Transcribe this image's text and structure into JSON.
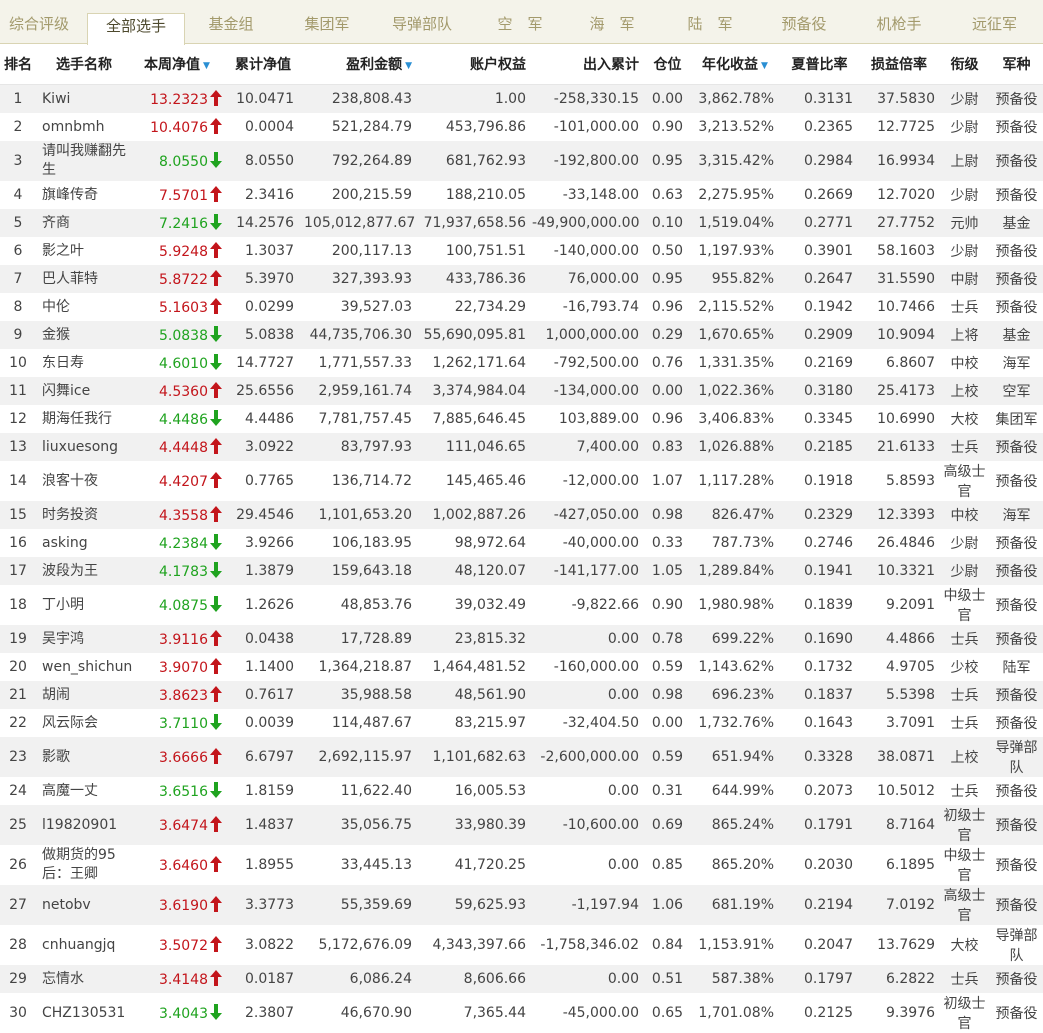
{
  "tabs": [
    {
      "label": "综合评级",
      "active": false
    },
    {
      "label": "全部选手",
      "active": true
    },
    {
      "label": "基金组",
      "active": false
    },
    {
      "label": "集团军",
      "active": false
    },
    {
      "label": "导弹部队",
      "active": false
    },
    {
      "label": "空　军",
      "active": false
    },
    {
      "label": "海　军",
      "active": false
    },
    {
      "label": "陆　军",
      "active": false
    },
    {
      "label": "预备役",
      "active": false
    },
    {
      "label": "机枪手",
      "active": false
    },
    {
      "label": "远征军",
      "active": false
    }
  ],
  "columns": [
    {
      "label": "排名",
      "sort": ""
    },
    {
      "label": "选手名称",
      "sort": ""
    },
    {
      "label": "本周净值",
      "sort": "▼"
    },
    {
      "label": "累计净值",
      "sort": ""
    },
    {
      "label": "盈利金额",
      "sort": "▼"
    },
    {
      "label": "账户权益",
      "sort": ""
    },
    {
      "label": "出入累计",
      "sort": ""
    },
    {
      "label": "仓位",
      "sort": ""
    },
    {
      "label": "年化收益",
      "sort": "▼"
    },
    {
      "label": "夏普比率",
      "sort": ""
    },
    {
      "label": "损益倍率",
      "sort": ""
    },
    {
      "label": "衔级",
      "sort": ""
    },
    {
      "label": "军种",
      "sort": ""
    }
  ],
  "colors": {
    "up": "#c3151b",
    "down": "#1fa31f",
    "tab_text": "#a39a6c",
    "row_alt": "#f1f1f1"
  },
  "rows": [
    {
      "rank": "1",
      "name": "Kiwi",
      "weekly": "13.2323",
      "dir": "up",
      "cum": "10.0471",
      "profit": "238,808.43",
      "equity": "1.00",
      "flow": "-258,330.15",
      "pos": "0.00",
      "annual": "3,862.78%",
      "sharpe": "0.3131",
      "ratio": "37.5830",
      "grade": "少尉",
      "branch": "预备役"
    },
    {
      "rank": "2",
      "name": "omnbmh",
      "weekly": "10.4076",
      "dir": "up",
      "cum": "0.0004",
      "profit": "521,284.79",
      "equity": "453,796.86",
      "flow": "-101,000.00",
      "pos": "0.90",
      "annual": "3,213.52%",
      "sharpe": "0.2365",
      "ratio": "12.7725",
      "grade": "少尉",
      "branch": "预备役"
    },
    {
      "rank": "3",
      "name": "请叫我赚翻先生",
      "weekly": "8.0550",
      "dir": "down",
      "cum": "8.0550",
      "profit": "792,264.89",
      "equity": "681,762.93",
      "flow": "-192,800.00",
      "pos": "0.95",
      "annual": "3,315.42%",
      "sharpe": "0.2984",
      "ratio": "16.9934",
      "grade": "上尉",
      "branch": "预备役",
      "tall": true
    },
    {
      "rank": "4",
      "name": "旗峰传奇",
      "weekly": "7.5701",
      "dir": "up",
      "cum": "2.3416",
      "profit": "200,215.59",
      "equity": "188,210.05",
      "flow": "-33,148.00",
      "pos": "0.63",
      "annual": "2,275.95%",
      "sharpe": "0.2669",
      "ratio": "12.7020",
      "grade": "少尉",
      "branch": "预备役"
    },
    {
      "rank": "5",
      "name": "齐商",
      "weekly": "7.2416",
      "dir": "down",
      "cum": "14.2576",
      "profit": "105,012,877.67",
      "equity": "71,937,658.56",
      "flow": "-49,900,000.00",
      "pos": "0.10",
      "annual": "1,519.04%",
      "sharpe": "0.2771",
      "ratio": "27.7752",
      "grade": "元帅",
      "branch": "基金"
    },
    {
      "rank": "6",
      "name": "影之叶",
      "weekly": "5.9248",
      "dir": "up",
      "cum": "1.3037",
      "profit": "200,117.13",
      "equity": "100,751.51",
      "flow": "-140,000.00",
      "pos": "0.50",
      "annual": "1,197.93%",
      "sharpe": "0.3901",
      "ratio": "58.1603",
      "grade": "少尉",
      "branch": "预备役"
    },
    {
      "rank": "7",
      "name": "巴人菲特",
      "weekly": "5.8722",
      "dir": "up",
      "cum": "5.3970",
      "profit": "327,393.93",
      "equity": "433,786.36",
      "flow": "76,000.00",
      "pos": "0.95",
      "annual": "955.82%",
      "sharpe": "0.2647",
      "ratio": "31.5590",
      "grade": "中尉",
      "branch": "预备役"
    },
    {
      "rank": "8",
      "name": "中伦",
      "weekly": "5.1603",
      "dir": "up",
      "cum": "0.0299",
      "profit": "39,527.03",
      "equity": "22,734.29",
      "flow": "-16,793.74",
      "pos": "0.96",
      "annual": "2,115.52%",
      "sharpe": "0.1942",
      "ratio": "10.7466",
      "grade": "士兵",
      "branch": "预备役"
    },
    {
      "rank": "9",
      "name": "金猴",
      "weekly": "5.0838",
      "dir": "down",
      "cum": "5.0838",
      "profit": "44,735,706.30",
      "equity": "55,690,095.81",
      "flow": "1,000,000.00",
      "pos": "0.29",
      "annual": "1,670.65%",
      "sharpe": "0.2909",
      "ratio": "10.9094",
      "grade": "上将",
      "branch": "基金"
    },
    {
      "rank": "10",
      "name": "东日寿",
      "weekly": "4.6010",
      "dir": "down",
      "cum": "14.7727",
      "profit": "1,771,557.33",
      "equity": "1,262,171.64",
      "flow": "-792,500.00",
      "pos": "0.76",
      "annual": "1,331.35%",
      "sharpe": "0.2169",
      "ratio": "6.8607",
      "grade": "中校",
      "branch": "海军"
    },
    {
      "rank": "11",
      "name": "闪舞ice",
      "weekly": "4.5360",
      "dir": "up",
      "cum": "25.6556",
      "profit": "2,959,161.74",
      "equity": "3,374,984.04",
      "flow": "-134,000.00",
      "pos": "0.00",
      "annual": "1,022.36%",
      "sharpe": "0.3180",
      "ratio": "25.4173",
      "grade": "上校",
      "branch": "空军"
    },
    {
      "rank": "12",
      "name": "期海任我行",
      "weekly": "4.4486",
      "dir": "down",
      "cum": "4.4486",
      "profit": "7,781,757.45",
      "equity": "7,885,646.45",
      "flow": "103,889.00",
      "pos": "0.96",
      "annual": "3,406.83%",
      "sharpe": "0.3345",
      "ratio": "10.6990",
      "grade": "大校",
      "branch": "集团军"
    },
    {
      "rank": "13",
      "name": "liuxuesong",
      "weekly": "4.4448",
      "dir": "up",
      "cum": "3.0922",
      "profit": "83,797.93",
      "equity": "111,046.65",
      "flow": "7,400.00",
      "pos": "0.83",
      "annual": "1,026.88%",
      "sharpe": "0.2185",
      "ratio": "21.6133",
      "grade": "士兵",
      "branch": "预备役"
    },
    {
      "rank": "14",
      "name": "浪客十夜",
      "weekly": "4.4207",
      "dir": "up",
      "cum": "0.7765",
      "profit": "136,714.72",
      "equity": "145,465.46",
      "flow": "-12,000.00",
      "pos": "1.07",
      "annual": "1,117.28%",
      "sharpe": "0.1918",
      "ratio": "5.8593",
      "grade": "高级士官",
      "branch": "预备役"
    },
    {
      "rank": "15",
      "name": "时务投资",
      "weekly": "4.3558",
      "dir": "up",
      "cum": "29.4546",
      "profit": "1,101,653.20",
      "equity": "1,002,887.26",
      "flow": "-427,050.00",
      "pos": "0.98",
      "annual": "826.47%",
      "sharpe": "0.2329",
      "ratio": "12.3393",
      "grade": "中校",
      "branch": "海军"
    },
    {
      "rank": "16",
      "name": "asking",
      "weekly": "4.2384",
      "dir": "down",
      "cum": "3.9266",
      "profit": "106,183.95",
      "equity": "98,972.64",
      "flow": "-40,000.00",
      "pos": "0.33",
      "annual": "787.73%",
      "sharpe": "0.2746",
      "ratio": "26.4846",
      "grade": "少尉",
      "branch": "预备役"
    },
    {
      "rank": "17",
      "name": "波段为王",
      "weekly": "4.1783",
      "dir": "down",
      "cum": "1.3879",
      "profit": "159,643.18",
      "equity": "48,120.07",
      "flow": "-141,177.00",
      "pos": "1.05",
      "annual": "1,289.84%",
      "sharpe": "0.1941",
      "ratio": "10.3321",
      "grade": "少尉",
      "branch": "预备役"
    },
    {
      "rank": "18",
      "name": "丁小明",
      "weekly": "4.0875",
      "dir": "down",
      "cum": "1.2626",
      "profit": "48,853.76",
      "equity": "39,032.49",
      "flow": "-9,822.66",
      "pos": "0.90",
      "annual": "1,980.98%",
      "sharpe": "0.1839",
      "ratio": "9.2091",
      "grade": "中级士官",
      "branch": "预备役"
    },
    {
      "rank": "19",
      "name": "吴宇鸿",
      "weekly": "3.9116",
      "dir": "up",
      "cum": "0.0438",
      "profit": "17,728.89",
      "equity": "23,815.32",
      "flow": "0.00",
      "pos": "0.78",
      "annual": "699.22%",
      "sharpe": "0.1690",
      "ratio": "4.4866",
      "grade": "士兵",
      "branch": "预备役"
    },
    {
      "rank": "20",
      "name": "wen_shichun",
      "weekly": "3.9070",
      "dir": "up",
      "cum": "1.1400",
      "profit": "1,364,218.87",
      "equity": "1,464,481.52",
      "flow": "-160,000.00",
      "pos": "0.59",
      "annual": "1,143.62%",
      "sharpe": "0.1732",
      "ratio": "4.9705",
      "grade": "少校",
      "branch": "陆军"
    },
    {
      "rank": "21",
      "name": "胡闹",
      "weekly": "3.8623",
      "dir": "up",
      "cum": "0.7617",
      "profit": "35,988.58",
      "equity": "48,561.90",
      "flow": "0.00",
      "pos": "0.98",
      "annual": "696.23%",
      "sharpe": "0.1837",
      "ratio": "5.5398",
      "grade": "士兵",
      "branch": "预备役"
    },
    {
      "rank": "22",
      "name": "风云际会",
      "weekly": "3.7110",
      "dir": "down",
      "cum": "0.0039",
      "profit": "114,487.67",
      "equity": "83,215.97",
      "flow": "-32,404.50",
      "pos": "0.00",
      "annual": "1,732.76%",
      "sharpe": "0.1643",
      "ratio": "3.7091",
      "grade": "士兵",
      "branch": "预备役"
    },
    {
      "rank": "23",
      "name": "影歌",
      "weekly": "3.6666",
      "dir": "up",
      "cum": "6.6797",
      "profit": "2,692,115.97",
      "equity": "1,101,682.63",
      "flow": "-2,600,000.00",
      "pos": "0.59",
      "annual": "651.94%",
      "sharpe": "0.3328",
      "ratio": "38.0871",
      "grade": "上校",
      "branch": "导弹部队"
    },
    {
      "rank": "24",
      "name": "高魔一丈",
      "weekly": "3.6516",
      "dir": "down",
      "cum": "1.8159",
      "profit": "11,622.40",
      "equity": "16,005.53",
      "flow": "0.00",
      "pos": "0.31",
      "annual": "644.99%",
      "sharpe": "0.2073",
      "ratio": "10.5012",
      "grade": "士兵",
      "branch": "预备役"
    },
    {
      "rank": "25",
      "name": "l19820901",
      "weekly": "3.6474",
      "dir": "up",
      "cum": "1.4837",
      "profit": "35,056.75",
      "equity": "33,980.39",
      "flow": "-10,600.00",
      "pos": "0.69",
      "annual": "865.24%",
      "sharpe": "0.1791",
      "ratio": "8.7164",
      "grade": "初级士官",
      "branch": "预备役"
    },
    {
      "rank": "26",
      "name": "做期货的95后：王卿",
      "weekly": "3.6460",
      "dir": "up",
      "cum": "1.8955",
      "profit": "33,445.13",
      "equity": "41,720.25",
      "flow": "0.00",
      "pos": "0.85",
      "annual": "865.20%",
      "sharpe": "0.2030",
      "ratio": "6.1895",
      "grade": "中级士官",
      "branch": "预备役",
      "tall": true
    },
    {
      "rank": "27",
      "name": "netobv",
      "weekly": "3.6190",
      "dir": "up",
      "cum": "3.3773",
      "profit": "55,359.69",
      "equity": "59,625.93",
      "flow": "-1,197.94",
      "pos": "1.06",
      "annual": "681.19%",
      "sharpe": "0.2194",
      "ratio": "7.0192",
      "grade": "高级士官",
      "branch": "预备役"
    },
    {
      "rank": "28",
      "name": "cnhuangjq",
      "weekly": "3.5072",
      "dir": "up",
      "cum": "3.0822",
      "profit": "5,172,676.09",
      "equity": "4,343,397.66",
      "flow": "-1,758,346.02",
      "pos": "0.84",
      "annual": "1,153.91%",
      "sharpe": "0.2047",
      "ratio": "13.7629",
      "grade": "大校",
      "branch": "导弹部队"
    },
    {
      "rank": "29",
      "name": "忘情水",
      "weekly": "3.4148",
      "dir": "up",
      "cum": "0.0187",
      "profit": "6,086.24",
      "equity": "8,606.66",
      "flow": "0.00",
      "pos": "0.51",
      "annual": "587.38%",
      "sharpe": "0.1797",
      "ratio": "6.2822",
      "grade": "士兵",
      "branch": "预备役"
    },
    {
      "rank": "30",
      "name": "CHZ130531",
      "weekly": "3.4043",
      "dir": "down",
      "cum": "2.3807",
      "profit": "46,670.90",
      "equity": "7,365.44",
      "flow": "-45,000.00",
      "pos": "0.65",
      "annual": "1,701.08%",
      "sharpe": "0.2125",
      "ratio": "9.3976",
      "grade": "初级士官",
      "branch": "预备役"
    }
  ]
}
